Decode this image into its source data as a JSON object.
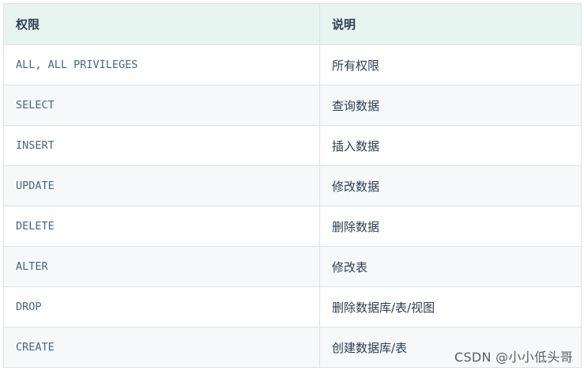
{
  "table": {
    "headers": [
      "权限",
      "说明"
    ],
    "rows": [
      {
        "privilege": "ALL, ALL PRIVILEGES",
        "description": "所有权限"
      },
      {
        "privilege": "SELECT",
        "description": "查询数据"
      },
      {
        "privilege": "INSERT",
        "description": "插入数据"
      },
      {
        "privilege": "UPDATE",
        "description": "修改数据"
      },
      {
        "privilege": "DELETE",
        "description": "删除数据"
      },
      {
        "privilege": "ALTER",
        "description": "修改表"
      },
      {
        "privilege": "DROP",
        "description": "删除数据库/表/视图"
      },
      {
        "privilege": "CREATE",
        "description": "创建数据库/表"
      }
    ]
  },
  "watermark": "CSDN @小小低头哥",
  "colors": {
    "header_bg": "#e6f5ef",
    "stripe_bg": "#f6f8fa",
    "border": "#dfe2e5",
    "code_text": "#476582",
    "body_text": "#2c3e50"
  }
}
